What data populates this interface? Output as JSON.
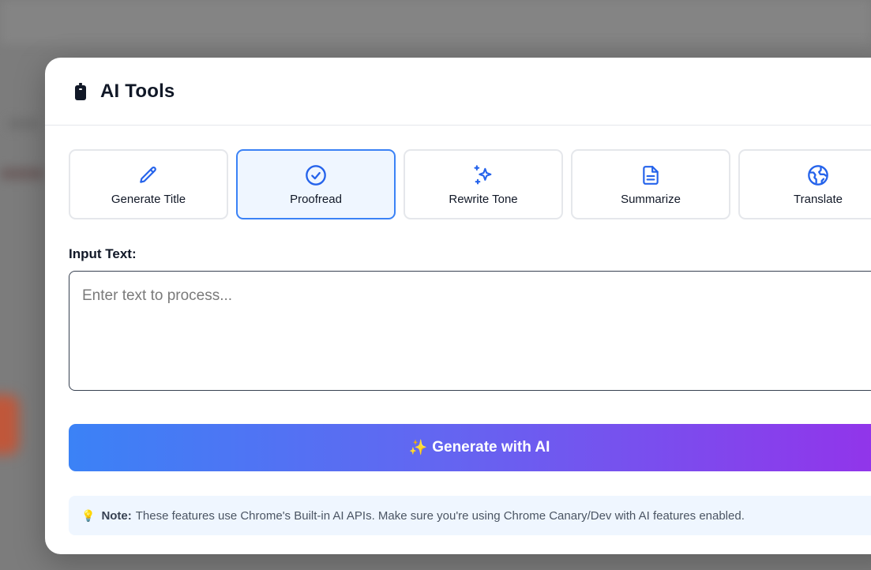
{
  "modal": {
    "title": "AI Tools",
    "header_icon": "battery-icon"
  },
  "tools": [
    {
      "label": "Generate Title",
      "icon": "pencil-icon",
      "active": false
    },
    {
      "label": "Proofread",
      "icon": "check-circle-icon",
      "active": true
    },
    {
      "label": "Rewrite Tone",
      "icon": "sparkles-icon",
      "active": false
    },
    {
      "label": "Summarize",
      "icon": "document-icon",
      "active": false
    },
    {
      "label": "Translate",
      "icon": "globe-icon",
      "active": false
    }
  ],
  "input": {
    "label": "Input Text:",
    "placeholder": "Enter text to process...",
    "value": ""
  },
  "generate": {
    "icon": "✨",
    "label": "Generate with AI"
  },
  "note": {
    "icon": "💡",
    "prefix": "Note:",
    "text": "These features use Chrome's Built-in AI APIs. Make sure you're using Chrome Canary/Dev with AI features enabled."
  },
  "colors": {
    "accent": "#3b82f6",
    "active_bg": "#eff6ff",
    "gradient_start": "#3b82f6",
    "gradient_end": "#9333ea"
  }
}
